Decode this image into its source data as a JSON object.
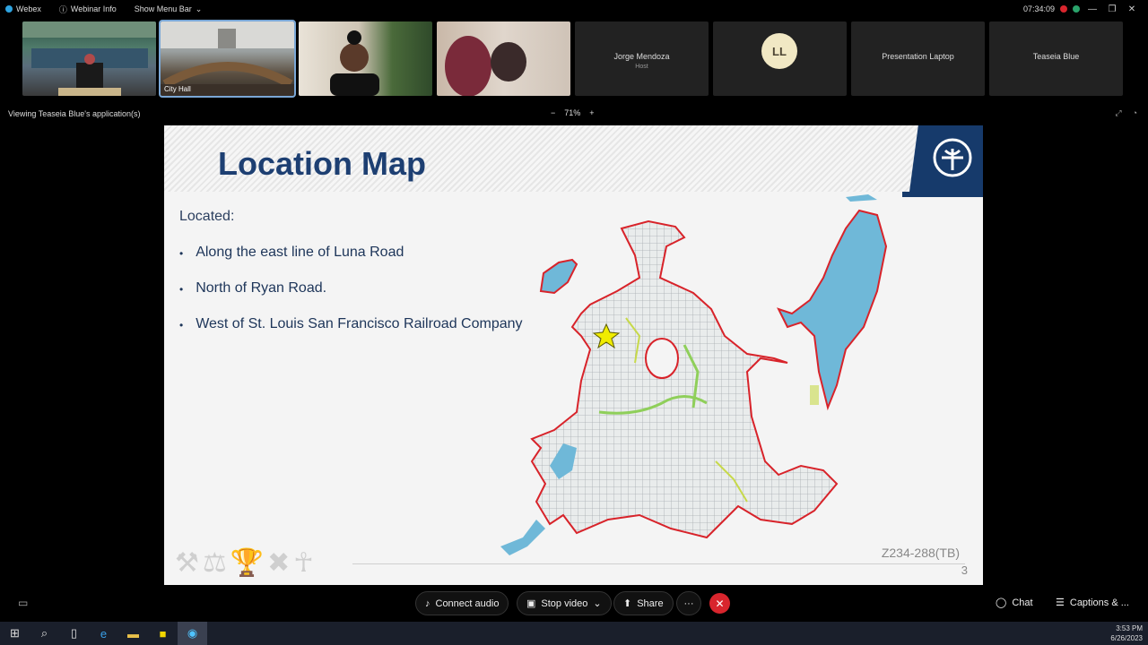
{
  "topbar": {
    "app_name": "Webex",
    "webinar_info": "Webinar Info",
    "show_menu": "Show Menu Bar",
    "timer": "07:34:09"
  },
  "participants": [
    {
      "caption": ""
    },
    {
      "caption": "City Hall"
    },
    {
      "caption": ""
    },
    {
      "caption": ""
    },
    {
      "name": "Jorge Mendoza",
      "sub": "Host"
    },
    {
      "initials": "LL"
    },
    {
      "name": "Presentation Laptop"
    },
    {
      "name": "Teaseia Blue"
    }
  ],
  "viewing": {
    "label": "Viewing Teaseia Blue's application(s)",
    "zoom_out": "−",
    "zoom_level": "71%",
    "zoom_in": "+"
  },
  "slide": {
    "title": "Location Map",
    "located_label": "Located:",
    "bullets": [
      "Along the east line of Luna Road",
      "North of Ryan Road.",
      "West of St. Louis San Francisco Railroad Company"
    ],
    "case_number": "Z234-288(TB)",
    "page_number": "3"
  },
  "controls": {
    "connect_audio": "Connect audio",
    "stop_video": "Stop video",
    "share": "Share",
    "more": "···",
    "end": "✕",
    "chat": "Chat",
    "captions": "Captions & ..."
  },
  "taskbar": {
    "time": "3:53 PM",
    "date": "6/26/2023"
  },
  "colors": {
    "slide_title": "#1d3f72",
    "city_boundary": "#d8232a",
    "water": "#6fb8d8",
    "end_button": "#d8252d"
  }
}
